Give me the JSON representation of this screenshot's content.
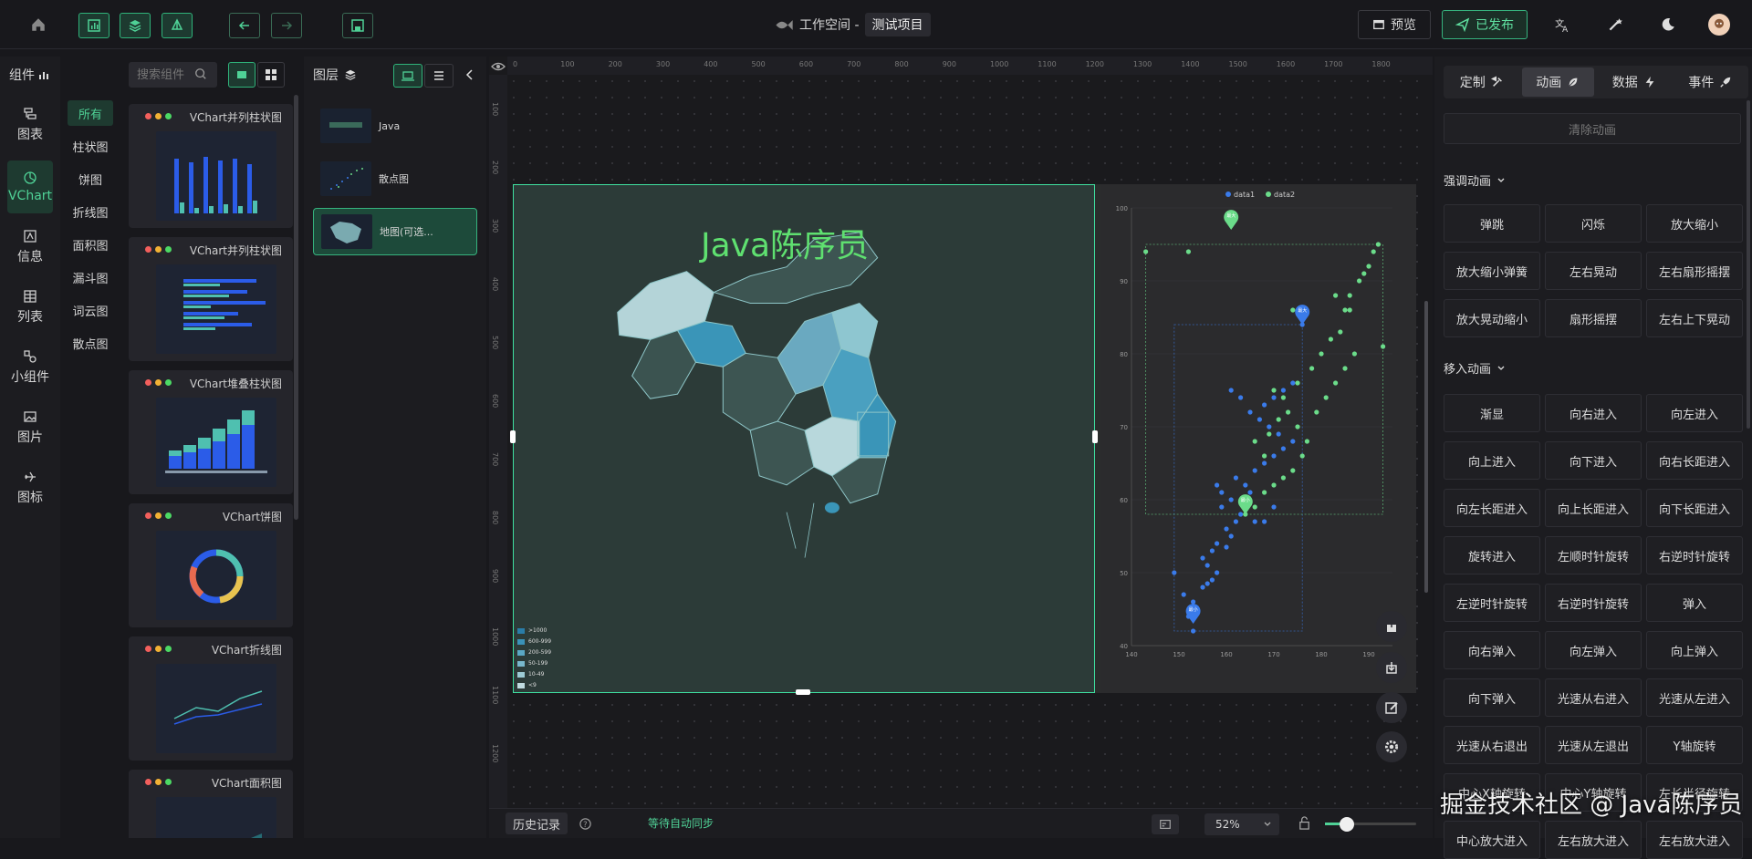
{
  "topbar": {
    "workspace_label": "工作空间 -",
    "project_name": "测试项目",
    "preview_label": "预览",
    "publish_label": "已发布"
  },
  "leftnav": {
    "header_label": "组件",
    "items": [
      {
        "label": "图表"
      },
      {
        "label": "VChart"
      },
      {
        "label": "信息"
      },
      {
        "label": "列表"
      },
      {
        "label": "小组件"
      },
      {
        "label": "图片"
      },
      {
        "label": "图标"
      }
    ],
    "subitems": [
      "所有",
      "柱状图",
      "饼图",
      "折线图",
      "面积图",
      "漏斗图",
      "词云图",
      "散点图"
    ],
    "search_placeholder": "搜索组件"
  },
  "components": [
    {
      "title": "VChart并列柱状图"
    },
    {
      "title": "VChart并列柱状图"
    },
    {
      "title": "VChart堆叠柱状图"
    },
    {
      "title": "VChart饼图"
    },
    {
      "title": "VChart折线图"
    },
    {
      "title": "VChart面积图"
    }
  ],
  "layers": {
    "header_label": "图层",
    "items": [
      {
        "label": "Java"
      },
      {
        "label": "散点图"
      },
      {
        "label": "地图(可选..."
      }
    ]
  },
  "canvas": {
    "map_title": "Java陈序员",
    "ruler_top": [
      "0",
      "100",
      "200",
      "300",
      "400",
      "500",
      "600",
      "700",
      "800",
      "900",
      "1000",
      "1100",
      "1200",
      "1300",
      "1400",
      "1500",
      "1600",
      "1700",
      "1800"
    ],
    "ruler_left": [
      "100",
      "200",
      "300",
      "400",
      "500",
      "600",
      "700",
      "800",
      "900",
      "1000",
      "1100",
      "1200"
    ],
    "map_legend": [
      ">1000",
      "600-999",
      "200-599",
      "50-199",
      "10-49",
      "<9"
    ],
    "map_legend_colors": [
      "#2a7da8",
      "#3a92b8",
      "#5aa8c4",
      "#78b8cc",
      "#9ccbd4",
      "#c0dce0"
    ]
  },
  "chart_data": {
    "type": "scatter",
    "legend": [
      "data1",
      "data2"
    ],
    "series_colors": [
      "#3a7bea",
      "#6bdc8a"
    ],
    "xlim": [
      140,
      195
    ],
    "ylim": [
      40,
      100
    ],
    "xticks": [
      140,
      150,
      160,
      170,
      180,
      190
    ],
    "yticks": [
      40,
      50,
      60,
      70,
      80,
      90,
      100
    ],
    "series": [
      {
        "name": "data1",
        "points": [
          [
            153,
            42
          ],
          [
            152,
            44
          ],
          [
            153,
            46
          ],
          [
            151,
            47
          ],
          [
            155,
            48
          ],
          [
            156,
            48.5
          ],
          [
            157,
            49
          ],
          [
            158,
            50
          ],
          [
            156,
            51
          ],
          [
            155,
            52
          ],
          [
            157,
            53
          ],
          [
            160,
            53.5
          ],
          [
            158,
            54
          ],
          [
            161,
            55
          ],
          [
            160,
            56
          ],
          [
            162,
            57
          ],
          [
            163,
            58
          ],
          [
            159,
            59
          ],
          [
            161,
            60
          ],
          [
            165,
            61
          ],
          [
            164,
            62
          ],
          [
            162,
            63
          ],
          [
            166,
            64
          ],
          [
            168,
            65
          ],
          [
            170,
            66
          ],
          [
            172,
            67
          ],
          [
            174,
            68
          ],
          [
            171,
            69
          ],
          [
            169,
            70
          ],
          [
            167,
            71
          ],
          [
            165,
            72
          ],
          [
            168,
            73
          ],
          [
            170,
            74
          ],
          [
            172,
            75
          ],
          [
            174,
            76
          ],
          [
            176,
            84
          ],
          [
            161,
            75
          ],
          [
            163,
            74
          ],
          [
            158,
            62
          ],
          [
            159,
            61
          ],
          [
            166,
            57
          ],
          [
            168,
            57
          ],
          [
            170,
            59
          ],
          [
            149,
            50
          ]
        ]
      },
      {
        "name": "data2",
        "points": [
          [
            143,
            94
          ],
          [
            152,
            94
          ],
          [
            164,
            58
          ],
          [
            166,
            59
          ],
          [
            168,
            61
          ],
          [
            170,
            62
          ],
          [
            172,
            63
          ],
          [
            174,
            64
          ],
          [
            170,
            75
          ],
          [
            172,
            74
          ],
          [
            175,
            76
          ],
          [
            178,
            78
          ],
          [
            180,
            80
          ],
          [
            182,
            82
          ],
          [
            184,
            83
          ],
          [
            185,
            86
          ],
          [
            186,
            88
          ],
          [
            188,
            90
          ],
          [
            189,
            91
          ],
          [
            190,
            92
          ],
          [
            191,
            94
          ],
          [
            192,
            95
          ],
          [
            193,
            81
          ],
          [
            185,
            78
          ],
          [
            187,
            80
          ],
          [
            183,
            76
          ],
          [
            181,
            74
          ],
          [
            179,
            72
          ],
          [
            177,
            68
          ],
          [
            175,
            70
          ],
          [
            176,
            66
          ],
          [
            173,
            72
          ],
          [
            171,
            71
          ],
          [
            169,
            69
          ],
          [
            168,
            66
          ],
          [
            166,
            68
          ],
          [
            174,
            86
          ],
          [
            176,
            85
          ],
          [
            183,
            88
          ],
          [
            186,
            86
          ]
        ]
      }
    ],
    "markers": [
      {
        "label": "最大",
        "x": 161,
        "y": 97,
        "series": "data2"
      },
      {
        "label": "最大",
        "x": 176,
        "y": 84,
        "series": "data1"
      },
      {
        "label": "最小",
        "x": 164,
        "y": 58,
        "series": "data2"
      },
      {
        "label": "最小",
        "x": 153,
        "y": 43,
        "series": "data1"
      }
    ]
  },
  "bottombar": {
    "history_label": "历史记录",
    "sync_status": "等待自动同步",
    "zoom_value": "52%"
  },
  "rightpanel": {
    "tabs": [
      "定制",
      "动画",
      "数据",
      "事件"
    ],
    "clear_label": "清除动画",
    "emphasis_title": "强调动画",
    "emphasis": [
      "弹跳",
      "闪烁",
      "放大缩小",
      "放大缩小弹簧",
      "左右晃动",
      "左右扇形摇摆",
      "放大晃动缩小",
      "扇形摇摆",
      "左右上下晃动"
    ],
    "enter_title": "移入动画",
    "enter": [
      "渐显",
      "向右进入",
      "向左进入",
      "向上进入",
      "向下进入",
      "向右长距进入",
      "向左长距进入",
      "向上长距进入",
      "向下长距进入",
      "旋转进入",
      "左顺时针旋转",
      "右逆时针旋转",
      "左逆时针旋转",
      "右逆时针旋转",
      "弹入",
      "向右弹入",
      "向左弹入",
      "向上弹入",
      "向下弹入",
      "光速从右进入",
      "光速从左进入",
      "光速从右退出",
      "光速从左退出",
      "Y轴旋转",
      "中心X轴旋转",
      "中心Y轴旋转",
      "左长半径旋转",
      "中心放大进入",
      "左右放大进入",
      "左右放大进入"
    ]
  },
  "watermark": "掘金技术社区 @ Java陈序员"
}
